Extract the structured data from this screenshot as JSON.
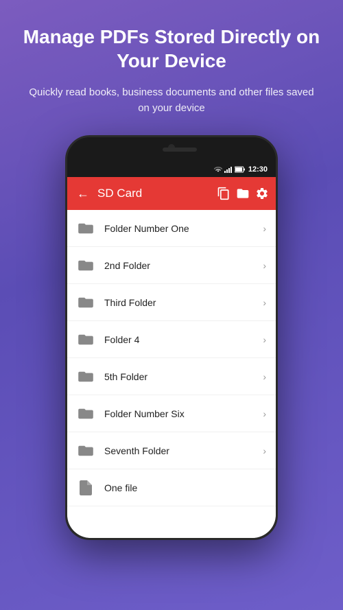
{
  "hero": {
    "title": "Manage PDFs Stored Directly on Your Device",
    "subtitle": "Quickly read books, business documents and other files saved on your device"
  },
  "phone": {
    "statusBar": {
      "time": "12:30"
    },
    "appBar": {
      "title": "SD Card",
      "backIcon": "←",
      "icons": [
        "file-copy",
        "folder-move",
        "settings"
      ]
    },
    "fileList": [
      {
        "id": 1,
        "name": "Folder Number One",
        "type": "folder"
      },
      {
        "id": 2,
        "name": "2nd Folder",
        "type": "folder"
      },
      {
        "id": 3,
        "name": "Third Folder",
        "type": "folder"
      },
      {
        "id": 4,
        "name": "Folder 4",
        "type": "folder"
      },
      {
        "id": 5,
        "name": "5th Folder",
        "type": "folder"
      },
      {
        "id": 6,
        "name": "Folder Number Six",
        "type": "folder"
      },
      {
        "id": 7,
        "name": "Seventh Folder",
        "type": "folder"
      },
      {
        "id": 8,
        "name": "One file",
        "type": "file"
      }
    ]
  }
}
